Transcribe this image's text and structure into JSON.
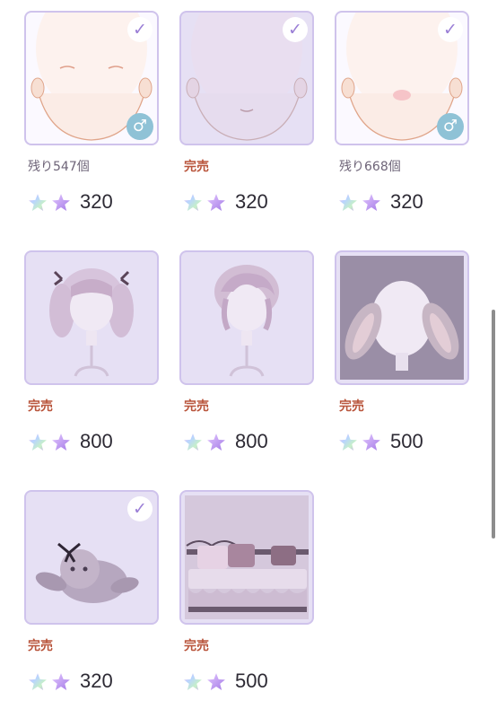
{
  "items": [
    {
      "name": "face-closed-eyes",
      "status": "残り547個",
      "sold_out": false,
      "price": "320",
      "checked": true,
      "male": true
    },
    {
      "name": "face-pale-mouth",
      "status": "完売",
      "sold_out": true,
      "price": "320",
      "checked": true,
      "male": false
    },
    {
      "name": "face-blush",
      "status": "残り668個",
      "sold_out": false,
      "price": "320",
      "checked": true,
      "male": true
    },
    {
      "name": "hair-twintail-curls",
      "status": "完売",
      "sold_out": true,
      "price": "800",
      "checked": false,
      "male": false
    },
    {
      "name": "hair-messy-short",
      "status": "完売",
      "sold_out": true,
      "price": "800",
      "checked": false,
      "male": false
    },
    {
      "name": "bunny-ears-hood",
      "status": "完売",
      "sold_out": true,
      "price": "500",
      "checked": false,
      "male": false
    },
    {
      "name": "bunny-plush",
      "status": "完売",
      "sold_out": true,
      "price": "320",
      "checked": true,
      "male": false
    },
    {
      "name": "frilly-bed",
      "status": "完売",
      "sold_out": true,
      "price": "500",
      "checked": false,
      "male": false
    }
  ],
  "icons": {
    "check": "✓",
    "male": "♂",
    "currency": "star-gem-currency-icon"
  },
  "colors": {
    "accent": "#9b7fd6",
    "sold_out": "#b9553c",
    "card_border": "#cfc3ec"
  }
}
